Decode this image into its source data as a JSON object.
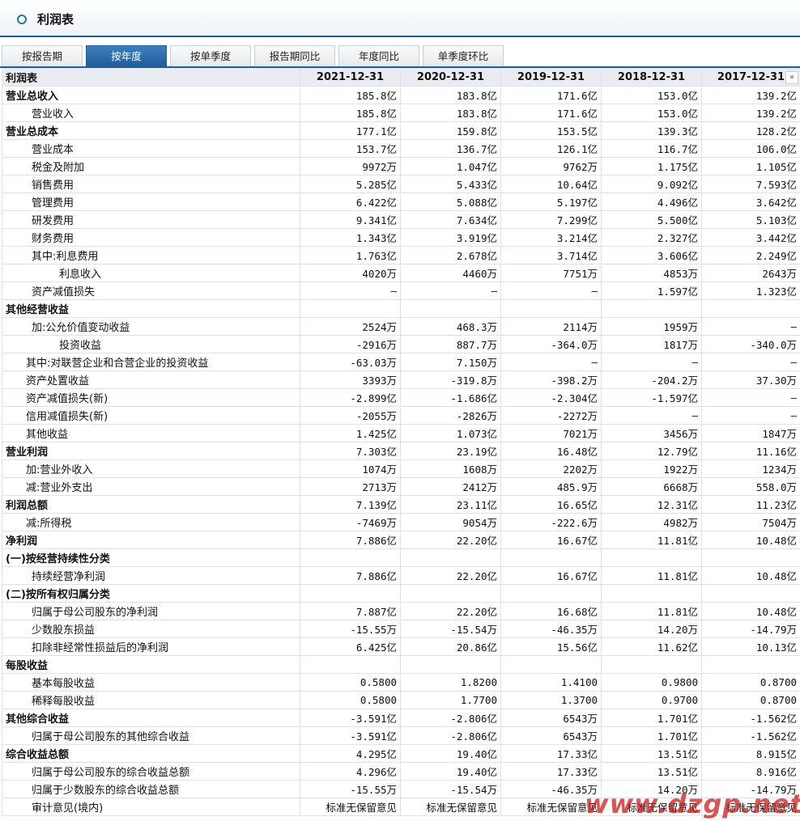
{
  "title": "利润表",
  "tabs": [
    {
      "label": "按报告期",
      "active": false
    },
    {
      "label": "按年度",
      "active": true
    },
    {
      "label": "按单季度",
      "active": false
    },
    {
      "label": "报告期同比",
      "active": false
    },
    {
      "label": "年度同比",
      "active": false
    },
    {
      "label": "单季度环比",
      "active": false
    }
  ],
  "table": {
    "header": [
      "利润表",
      "2021-12-31",
      "2020-12-31",
      "2019-12-31",
      "2018-12-31",
      "2017-12-31"
    ],
    "rows": [
      {
        "label": "营业总收入",
        "bold": true,
        "indent": 0,
        "values": [
          "185.8亿",
          "183.8亿",
          "171.6亿",
          "153.0亿",
          "139.2亿"
        ]
      },
      {
        "label": "营业收入",
        "bold": false,
        "indent": 1,
        "values": [
          "185.8亿",
          "183.8亿",
          "171.6亿",
          "153.0亿",
          "139.2亿"
        ]
      },
      {
        "label": "营业总成本",
        "bold": true,
        "indent": 0,
        "values": [
          "177.1亿",
          "159.8亿",
          "153.5亿",
          "139.3亿",
          "128.2亿"
        ]
      },
      {
        "label": "营业成本",
        "bold": false,
        "indent": 1,
        "values": [
          "153.7亿",
          "136.7亿",
          "126.1亿",
          "116.7亿",
          "106.0亿"
        ]
      },
      {
        "label": "税金及附加",
        "bold": false,
        "indent": 1,
        "values": [
          "9972万",
          "1.047亿",
          "9762万",
          "1.175亿",
          "1.105亿"
        ]
      },
      {
        "label": "销售费用",
        "bold": false,
        "indent": 1,
        "values": [
          "5.285亿",
          "5.433亿",
          "10.64亿",
          "9.092亿",
          "7.593亿"
        ]
      },
      {
        "label": "管理费用",
        "bold": false,
        "indent": 1,
        "values": [
          "6.422亿",
          "5.088亿",
          "5.197亿",
          "4.496亿",
          "3.642亿"
        ]
      },
      {
        "label": "研发费用",
        "bold": false,
        "indent": 1,
        "values": [
          "9.341亿",
          "7.634亿",
          "7.299亿",
          "5.500亿",
          "5.103亿"
        ]
      },
      {
        "label": "财务费用",
        "bold": false,
        "indent": 1,
        "values": [
          "1.343亿",
          "3.919亿",
          "3.214亿",
          "2.327亿",
          "3.442亿"
        ]
      },
      {
        "label": "其中:利息费用",
        "bold": false,
        "indent": 1,
        "values": [
          "1.763亿",
          "2.678亿",
          "3.714亿",
          "3.606亿",
          "2.249亿"
        ]
      },
      {
        "label": "利息收入",
        "bold": false,
        "indent": 2,
        "values": [
          "4020万",
          "4460万",
          "7751万",
          "4853万",
          "2643万"
        ]
      },
      {
        "label": "资产减值损失",
        "bold": false,
        "indent": 1,
        "values": [
          "—",
          "—",
          "—",
          "1.597亿",
          "1.323亿"
        ]
      },
      {
        "label": "其他经营收益",
        "bold": true,
        "indent": 0,
        "values": [
          "",
          "",
          "",
          "",
          ""
        ]
      },
      {
        "label": "加:公允价值变动收益",
        "bold": false,
        "indent": 1,
        "values": [
          "2524万",
          "468.3万",
          "2114万",
          "1959万",
          "—"
        ]
      },
      {
        "label": "投资收益",
        "bold": false,
        "indent": 3,
        "values": [
          "-2916万",
          "887.7万",
          "-364.0万",
          "1817万",
          "-340.0万"
        ]
      },
      {
        "label": "其中:对联营企业和合营企业的投资收益",
        "bold": false,
        "indent": 4,
        "values": [
          "-63.03万",
          "7.150万",
          "—",
          "—",
          "—"
        ]
      },
      {
        "label": "资产处置收益",
        "bold": false,
        "indent": 4,
        "values": [
          "3393万",
          "-319.8万",
          "-398.2万",
          "-204.2万",
          "37.30万"
        ]
      },
      {
        "label": "资产减值损失(新)",
        "bold": false,
        "indent": 4,
        "values": [
          "-2.899亿",
          "-1.686亿",
          "-2.304亿",
          "-1.597亿",
          "—"
        ]
      },
      {
        "label": "信用减值损失(新)",
        "bold": false,
        "indent": 4,
        "values": [
          "-2055万",
          "-2826万",
          "-2272万",
          "—",
          "—"
        ]
      },
      {
        "label": "其他收益",
        "bold": false,
        "indent": 4,
        "values": [
          "1.425亿",
          "1.073亿",
          "7021万",
          "3456万",
          "1847万"
        ]
      },
      {
        "label": "营业利润",
        "bold": true,
        "indent": 0,
        "values": [
          "7.303亿",
          "23.19亿",
          "16.48亿",
          "12.79亿",
          "11.16亿"
        ]
      },
      {
        "label": "加:营业外收入",
        "bold": false,
        "indent": 4,
        "values": [
          "1074万",
          "1608万",
          "2202万",
          "1922万",
          "1234万"
        ]
      },
      {
        "label": "减:营业外支出",
        "bold": false,
        "indent": 4,
        "values": [
          "2713万",
          "2412万",
          "485.9万",
          "6668万",
          "558.0万"
        ]
      },
      {
        "label": "利润总额",
        "bold": true,
        "indent": 0,
        "values": [
          "7.139亿",
          "23.11亿",
          "16.65亿",
          "12.31亿",
          "11.23亿"
        ]
      },
      {
        "label": "减:所得税",
        "bold": false,
        "indent": 4,
        "values": [
          "-7469万",
          "9054万",
          "-222.6万",
          "4982万",
          "7504万"
        ]
      },
      {
        "label": "净利润",
        "bold": true,
        "indent": 0,
        "values": [
          "7.886亿",
          "22.20亿",
          "16.67亿",
          "11.81亿",
          "10.48亿"
        ]
      },
      {
        "label": "(一)按经营持续性分类",
        "bold": true,
        "indent": 0,
        "values": [
          "",
          "",
          "",
          "",
          ""
        ]
      },
      {
        "label": "持续经营净利润",
        "bold": false,
        "indent": 1,
        "values": [
          "7.886亿",
          "22.20亿",
          "16.67亿",
          "11.81亿",
          "10.48亿"
        ]
      },
      {
        "label": "(二)按所有权归属分类",
        "bold": true,
        "indent": 0,
        "values": [
          "",
          "",
          "",
          "",
          ""
        ]
      },
      {
        "label": "归属于母公司股东的净利润",
        "bold": false,
        "indent": 1,
        "values": [
          "7.887亿",
          "22.20亿",
          "16.68亿",
          "11.81亿",
          "10.48亿"
        ]
      },
      {
        "label": "少数股东损益",
        "bold": false,
        "indent": 1,
        "values": [
          "-15.55万",
          "-15.54万",
          "-46.35万",
          "14.20万",
          "-14.79万"
        ]
      },
      {
        "label": "扣除非经常性损益后的净利润",
        "bold": false,
        "indent": 1,
        "values": [
          "6.425亿",
          "20.86亿",
          "15.56亿",
          "11.62亿",
          "10.13亿"
        ]
      },
      {
        "label": "每股收益",
        "bold": true,
        "indent": 0,
        "values": [
          "",
          "",
          "",
          "",
          ""
        ]
      },
      {
        "label": "基本每股收益",
        "bold": false,
        "indent": 1,
        "values": [
          "0.5800",
          "1.8200",
          "1.4100",
          "0.9800",
          "0.8700"
        ]
      },
      {
        "label": "稀释每股收益",
        "bold": false,
        "indent": 1,
        "values": [
          "0.5800",
          "1.7700",
          "1.3700",
          "0.9700",
          "0.8700"
        ]
      },
      {
        "label": "其他综合收益",
        "bold": true,
        "indent": 0,
        "values": [
          "-3.591亿",
          "-2.806亿",
          "6543万",
          "1.701亿",
          "-1.562亿"
        ]
      },
      {
        "label": "归属于母公司股东的其他综合收益",
        "bold": false,
        "indent": 1,
        "values": [
          "-3.591亿",
          "-2.806亿",
          "6543万",
          "1.701亿",
          "-1.562亿"
        ]
      },
      {
        "label": "综合收益总额",
        "bold": true,
        "indent": 0,
        "values": [
          "4.295亿",
          "19.40亿",
          "17.33亿",
          "13.51亿",
          "8.915亿"
        ]
      },
      {
        "label": "归属于母公司股东的综合收益总额",
        "bold": false,
        "indent": 1,
        "values": [
          "4.296亿",
          "19.40亿",
          "17.33亿",
          "13.51亿",
          "8.916亿"
        ]
      },
      {
        "label": "归属于少数股东的综合收益总额",
        "bold": false,
        "indent": 1,
        "values": [
          "-15.55万",
          "-15.54万",
          "-46.35万",
          "14.20万",
          "-14.79万"
        ]
      },
      {
        "label": "审计意见(境内)",
        "bold": false,
        "indent": 1,
        "values": [
          "标准无保留意见",
          "标准无保留意见",
          "标准无保留意见",
          "标准无保留意见",
          "标准无保留意见"
        ]
      }
    ]
  },
  "more_icon": "double-chevron-right-icon",
  "watermark": "www.dzgp.net",
  "colors": {
    "accent": "#1f5e99",
    "header_bg": "#e9edf1",
    "watermark": "#c81e1e"
  }
}
